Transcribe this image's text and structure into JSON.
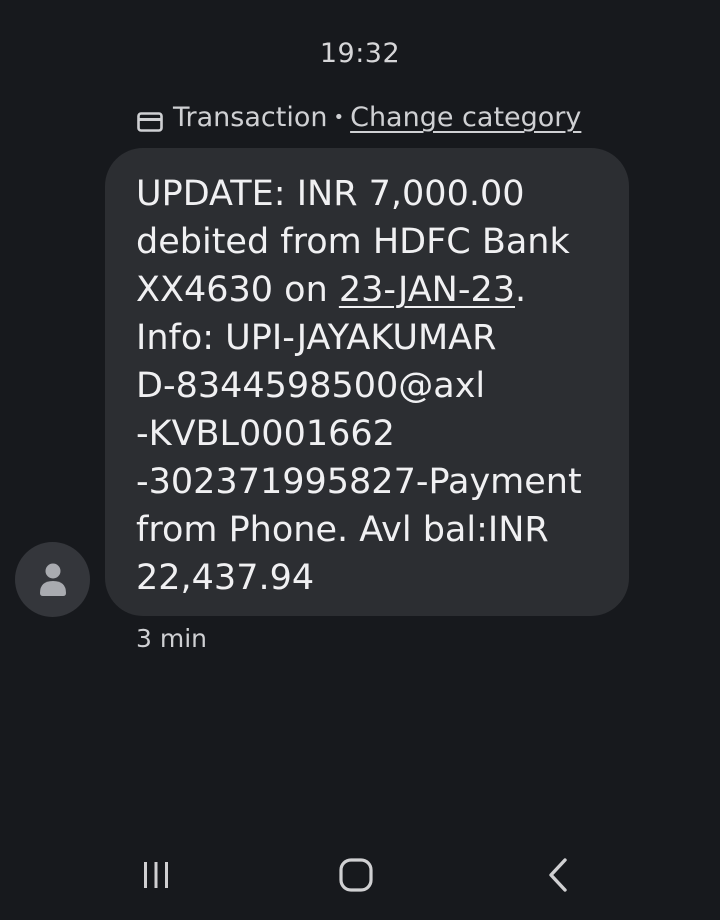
{
  "status": {
    "time": "19:32"
  },
  "category": {
    "icon": "card-icon",
    "label": "Transaction",
    "separator": "•",
    "change_label": "Change category"
  },
  "message": {
    "line1": "UPDATE: INR 7,000.00",
    "line2": "debited from HDFC Bank",
    "line3_prefix": "XX4630 on ",
    "line3_date": "23-JAN-23",
    "line3_suffix": ".",
    "line4": "Info: UPI-JAYAKUMAR",
    "line5": "D-8344598500@axl",
    "line6": "-KVBL0001662",
    "line7": "-302371995827-Payment",
    "line8": "from Phone. Avl bal:INR",
    "line9": "22,437.94",
    "timestamp": "3 min"
  },
  "sender": {
    "avatar_icon": "person-icon"
  },
  "navigation": {
    "recents_icon": "recents-icon",
    "home_icon": "home-icon",
    "back_icon": "back-icon"
  },
  "colors": {
    "background": "#17191d",
    "bubble": "#2c2e32",
    "text": "#f0f0f2",
    "muted": "#cfd0d3"
  }
}
